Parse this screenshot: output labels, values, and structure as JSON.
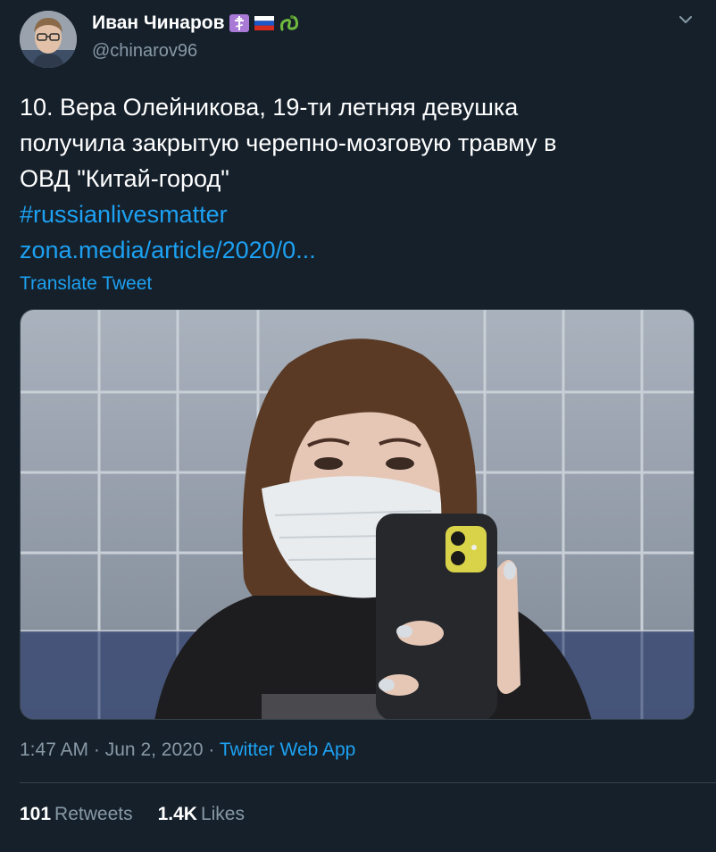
{
  "author": {
    "display_name": "Иван Чинаров",
    "handle": "@chinarov96",
    "badges": [
      "orthodox-cross-icon",
      "russia-flag-icon",
      "snake-icon"
    ]
  },
  "tweet": {
    "text_line_1": "10. Вера Олейникова, 19-ти летняя девушка",
    "text_line_2": "получила закрытую черепно-мозговую травму в",
    "text_line_3": "ОВД \"Китай-город\"",
    "hashtag": "#russianlivesmatter",
    "link": "zona.media/article/2020/0...",
    "translate_label": "Translate Tweet"
  },
  "meta": {
    "time": "1:47 AM",
    "separator": "·",
    "date": "Jun 2, 2020",
    "source": "Twitter Web App"
  },
  "stats": {
    "retweets_count": "101",
    "retweets_label": "Retweets",
    "likes_count": "1.4K",
    "likes_label": "Likes"
  },
  "media": {
    "description_icon": "photo-mirror-selfie"
  },
  "colors": {
    "background": "#15202b",
    "link": "#1da1f2",
    "secondary_text": "#8899a6",
    "border": "#38444d"
  }
}
